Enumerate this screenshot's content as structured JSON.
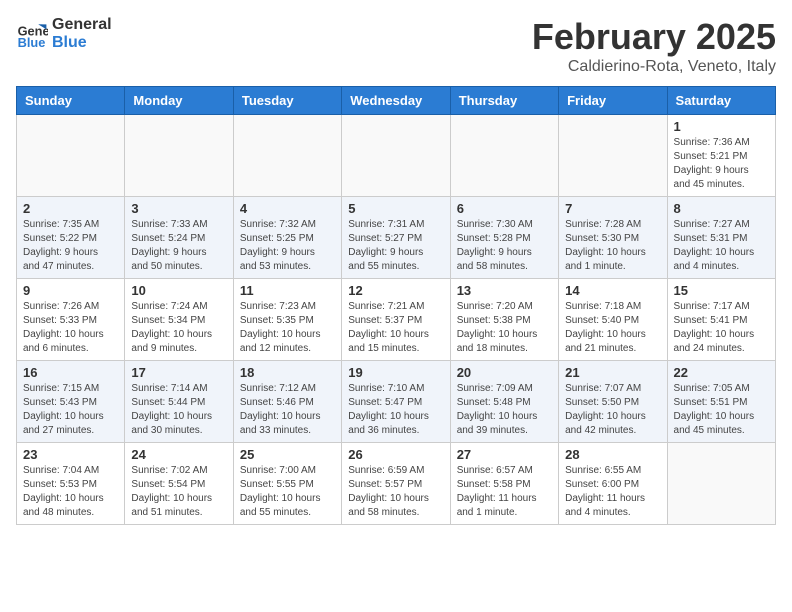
{
  "header": {
    "logo_line1": "General",
    "logo_line2": "Blue",
    "month_title": "February 2025",
    "location": "Caldierino-Rota, Veneto, Italy"
  },
  "days_of_week": [
    "Sunday",
    "Monday",
    "Tuesday",
    "Wednesday",
    "Thursday",
    "Friday",
    "Saturday"
  ],
  "weeks": [
    [
      {
        "day": "",
        "info": ""
      },
      {
        "day": "",
        "info": ""
      },
      {
        "day": "",
        "info": ""
      },
      {
        "day": "",
        "info": ""
      },
      {
        "day": "",
        "info": ""
      },
      {
        "day": "",
        "info": ""
      },
      {
        "day": "1",
        "info": "Sunrise: 7:36 AM\nSunset: 5:21 PM\nDaylight: 9 hours\nand 45 minutes."
      }
    ],
    [
      {
        "day": "2",
        "info": "Sunrise: 7:35 AM\nSunset: 5:22 PM\nDaylight: 9 hours\nand 47 minutes."
      },
      {
        "day": "3",
        "info": "Sunrise: 7:33 AM\nSunset: 5:24 PM\nDaylight: 9 hours\nand 50 minutes."
      },
      {
        "day": "4",
        "info": "Sunrise: 7:32 AM\nSunset: 5:25 PM\nDaylight: 9 hours\nand 53 minutes."
      },
      {
        "day": "5",
        "info": "Sunrise: 7:31 AM\nSunset: 5:27 PM\nDaylight: 9 hours\nand 55 minutes."
      },
      {
        "day": "6",
        "info": "Sunrise: 7:30 AM\nSunset: 5:28 PM\nDaylight: 9 hours\nand 58 minutes."
      },
      {
        "day": "7",
        "info": "Sunrise: 7:28 AM\nSunset: 5:30 PM\nDaylight: 10 hours\nand 1 minute."
      },
      {
        "day": "8",
        "info": "Sunrise: 7:27 AM\nSunset: 5:31 PM\nDaylight: 10 hours\nand 4 minutes."
      }
    ],
    [
      {
        "day": "9",
        "info": "Sunrise: 7:26 AM\nSunset: 5:33 PM\nDaylight: 10 hours\nand 6 minutes."
      },
      {
        "day": "10",
        "info": "Sunrise: 7:24 AM\nSunset: 5:34 PM\nDaylight: 10 hours\nand 9 minutes."
      },
      {
        "day": "11",
        "info": "Sunrise: 7:23 AM\nSunset: 5:35 PM\nDaylight: 10 hours\nand 12 minutes."
      },
      {
        "day": "12",
        "info": "Sunrise: 7:21 AM\nSunset: 5:37 PM\nDaylight: 10 hours\nand 15 minutes."
      },
      {
        "day": "13",
        "info": "Sunrise: 7:20 AM\nSunset: 5:38 PM\nDaylight: 10 hours\nand 18 minutes."
      },
      {
        "day": "14",
        "info": "Sunrise: 7:18 AM\nSunset: 5:40 PM\nDaylight: 10 hours\nand 21 minutes."
      },
      {
        "day": "15",
        "info": "Sunrise: 7:17 AM\nSunset: 5:41 PM\nDaylight: 10 hours\nand 24 minutes."
      }
    ],
    [
      {
        "day": "16",
        "info": "Sunrise: 7:15 AM\nSunset: 5:43 PM\nDaylight: 10 hours\nand 27 minutes."
      },
      {
        "day": "17",
        "info": "Sunrise: 7:14 AM\nSunset: 5:44 PM\nDaylight: 10 hours\nand 30 minutes."
      },
      {
        "day": "18",
        "info": "Sunrise: 7:12 AM\nSunset: 5:46 PM\nDaylight: 10 hours\nand 33 minutes."
      },
      {
        "day": "19",
        "info": "Sunrise: 7:10 AM\nSunset: 5:47 PM\nDaylight: 10 hours\nand 36 minutes."
      },
      {
        "day": "20",
        "info": "Sunrise: 7:09 AM\nSunset: 5:48 PM\nDaylight: 10 hours\nand 39 minutes."
      },
      {
        "day": "21",
        "info": "Sunrise: 7:07 AM\nSunset: 5:50 PM\nDaylight: 10 hours\nand 42 minutes."
      },
      {
        "day": "22",
        "info": "Sunrise: 7:05 AM\nSunset: 5:51 PM\nDaylight: 10 hours\nand 45 minutes."
      }
    ],
    [
      {
        "day": "23",
        "info": "Sunrise: 7:04 AM\nSunset: 5:53 PM\nDaylight: 10 hours\nand 48 minutes."
      },
      {
        "day": "24",
        "info": "Sunrise: 7:02 AM\nSunset: 5:54 PM\nDaylight: 10 hours\nand 51 minutes."
      },
      {
        "day": "25",
        "info": "Sunrise: 7:00 AM\nSunset: 5:55 PM\nDaylight: 10 hours\nand 55 minutes."
      },
      {
        "day": "26",
        "info": "Sunrise: 6:59 AM\nSunset: 5:57 PM\nDaylight: 10 hours\nand 58 minutes."
      },
      {
        "day": "27",
        "info": "Sunrise: 6:57 AM\nSunset: 5:58 PM\nDaylight: 11 hours\nand 1 minute."
      },
      {
        "day": "28",
        "info": "Sunrise: 6:55 AM\nSunset: 6:00 PM\nDaylight: 11 hours\nand 4 minutes."
      },
      {
        "day": "",
        "info": ""
      }
    ]
  ]
}
